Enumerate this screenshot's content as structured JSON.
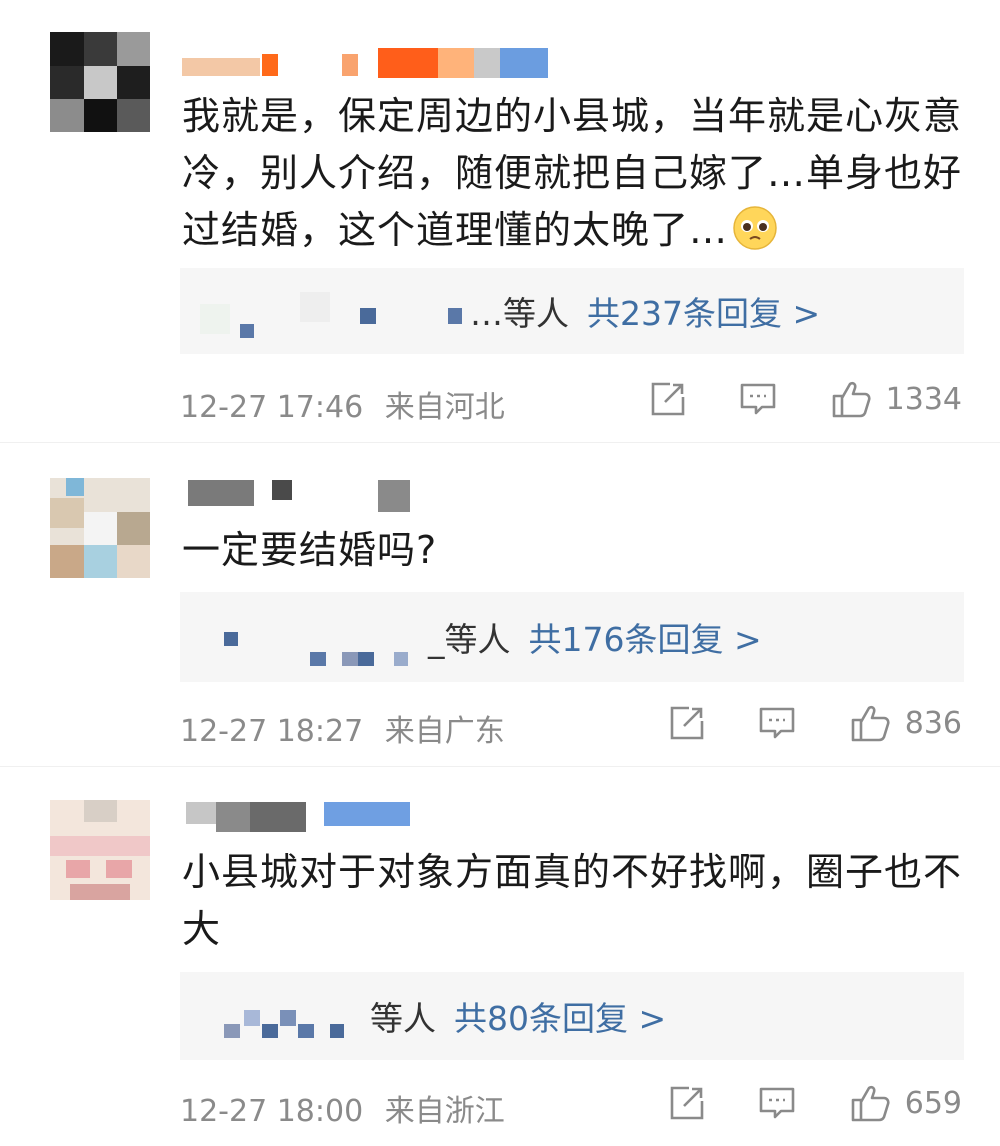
{
  "comments": [
    {
      "text": "我就是，保定周边的小县城，当年就是心灰意冷，别人介绍，随便就把自己嫁了…单身也好过结婚，这个道理懂的太晚了…",
      "emoji": "pleading-face-emoji",
      "replies_suffix": "…等人",
      "replies_count_label": "共237条回复 >",
      "timestamp": "12-27 17:46",
      "location": "来自河北",
      "likes": "1334"
    },
    {
      "text": "一定要结婚吗?",
      "replies_suffix": "_等人",
      "replies_count_label": "共176条回复 >",
      "timestamp": "12-27 18:27",
      "location": "来自广东",
      "likes": "836"
    },
    {
      "text": "小县城对于对象方面真的不好找啊，圈子也不大",
      "replies_suffix": "等人",
      "replies_count_label": "共80条回复 >",
      "timestamp": "12-27 18:00",
      "location": "来自浙江",
      "likes": "659"
    }
  ],
  "icons": {
    "share": "share-icon",
    "comment": "comment-icon",
    "like": "thumbs-up-icon"
  },
  "colors": {
    "link": "#3f6ea3",
    "meta": "#8a8a8a",
    "text": "#1a1a1a",
    "reply_box": "#f6f6f6"
  }
}
